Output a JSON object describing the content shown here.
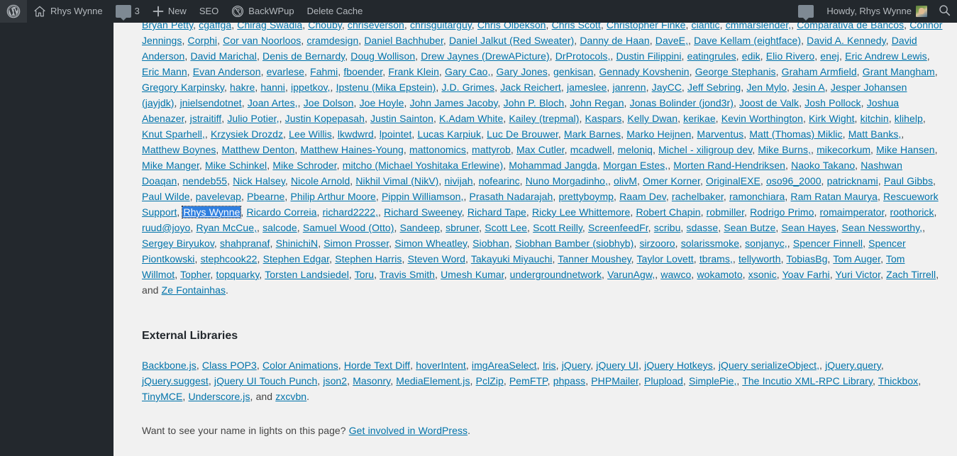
{
  "adminbar": {
    "logo_icon": "wordpress-logo-icon",
    "site_name": "Rhys Wynne",
    "site_icon": "home-icon",
    "comments_icon": "comment-bubble-icon",
    "comments_count": "3",
    "new_icon": "plus-icon",
    "new_label": "New",
    "seo_label": "SEO",
    "backwpup_icon": "backwpup-icon",
    "backwpup_label": "BackWPup",
    "delete_cache_label": "Delete Cache",
    "right_bubble_icon": "speech-bubble-icon",
    "howdy_label": "Howdy, Rhys Wynne",
    "avatar_name": "user-avatar",
    "search_icon": "search-icon"
  },
  "credits": {
    "contributor_lines": [
      "Bryan Petty, cgaffga, Chirag Swadia, Chouby, chriseverson, chrisguitarguy, Chris Olbekson, Chris Scott, Christopher Finke, ciantic, cmmarslender,",
      "Comparativa de Bancos, Connor Jennings, Corphi, Cor van Noorloos, cramdesign, Daniel Bachhuber, Daniel Jalkut (Red Sweater), Danny de Haan, DaveE,",
      "Dave Kellam (eightface), David A. Kennedy, David Anderson, David Marichal, Denis de Bernardy, Doug Wollison, Drew Jaynes (DrewAPicture), DrProtocols,",
      "Dustin Filippini, eatingrules, edik, Elio Rivero, enej, Eric Andrew Lewis, Eric Mann, Evan Anderson, evarlese, Fahmi, fboender, Frank Klein, Gary Cao,",
      "Gary Jones, genkisan, Gennady Kovshenin, George Stephanis, Graham Armfield, Grant Mangham, Gregory Karpinsky, hakre, hanni, ippetkov,",
      "Ipstenu (Mika Epstein), J.D. Grimes, Jack Reichert, jameslee, janrenn, JayCC, Jeff Sebring, Jen Mylo, Jesin A, Jesper Johansen (jayjdk), jnielsendotnet, Joan Artes,",
      "Joe Dolson, Joe Hoyle, John James Jacoby, John P. Bloch, John Regan, Jonas Bolinder (jond3r), Joost de Valk, Josh Pollock, Joshua Abenazer, jstraitiff, Julio Potier,",
      "Justin Kopepasah, Justin Sainton, K.Adam White, Kailey (trepmal), Kaspars, Kelly Dwan, kerikae, Kevin Worthington, Kirk Wight, kitchin, klihelp, Knut Sparhell,",
      "Krzysiek Drozdz, Lee Willis, lkwdwrd, lpointet, Lucas Karpiuk, Luc De Brouwer, Mark Barnes, Marko Heijnen, Marventus, Matt (Thomas) Miklic, Matt Banks,",
      "Matthew Boynes, Matthew Denton, Matthew Haines-Young, mattonomics, mattyrob, Max Cutler, mcadwell, meloniq, Michel - xiligroup dev, Mike Burns,",
      "mikecorkum, Mike Hansen, Mike Manger, Mike Schinkel, Mike Schroder, mitcho (Michael Yoshitaka Erlewine), Mohammad Jangda, Morgan Estes,",
      "Morten Rand-Hendriksen, Naoko Takano, Nashwan Doaqan, nendeb55, Nick Halsey, Nicole Arnold, Nikhil Vimal (NikV), nivijah, nofearinc, Nuno Morgadinho,",
      "olivM, Omer Korner, OriginalEXE, oso96_2000, patricknami, Paul Gibbs, Paul Wilde, pavelevap, Pbearne, Philip Arthur Moore, Pippin Williamson,",
      "Prasath Nadarajah, prettyboymp, Raam Dev, rachelbaker, ramonchiara, Ram Ratan Maurya, Rescuework Support, Rhys Wynne, Ricardo Correia, richard2222,",
      "Richard Sweeney, Richard Tape, Ricky Lee Whittemore, Robert Chapin, robmiller, Rodrigo Primo, romaimperator, roothorick, ruud@joyo, Ryan McCue,",
      "salcode, Samuel Wood (Otto), Sandeep, sbruner, Scott Lee, Scott Reilly, ScreenfeedFr, scribu, sdasse, Sean Butze, Sean Hayes, Sean Nessworthy,",
      "Sergey Biryukov, shahpranaf, ShinichiN, Simon Prosser, Simon Wheatley, Siobhan, Siobhan Bamber (siobhyb), sirzooro, solarissmoke, sonjanyc,",
      "Spencer Finnell, Spencer Piontkowski, stephcook22, Stephen Edgar, Stephen Harris, Steven Word, Takayuki Miyauchi, Tanner Moushey, Taylor Lovett, tbrams,",
      "tellyworth, TobiasBg, Tom Auger, Tom Willmot, Topher, topquarky, Torsten Landsiedel, Toru, Travis Smith, Umesh Kumar, undergroundnetwork, VarunAgw,",
      "wawco, wokamoto, xsonic, Yoav Farhi, Yuri Victor, Zach Tirrell, and Ze Fontainhas."
    ],
    "focused_link": "Rhys Wynne",
    "and_label": "and"
  },
  "external_libraries": {
    "heading": "External Libraries",
    "lines": [
      "Backbone.js, Class POP3, Color Animations, Horde Text Diff, hoverIntent, imgAreaSelect, Iris, jQuery, jQuery UI, jQuery Hotkeys, jQuery serializeObject,",
      "jQuery.query, jQuery.suggest, jQuery UI Touch Punch, json2, Masonry, MediaElement.js, PclZip, PemFTP, phpass, PHPMailer, Plupload, SimplePie,",
      "The Incutio XML-RPC Library, Thickbox, TinyMCE, Underscore.js, and zxcvbn."
    ]
  },
  "footer": {
    "prompt_text": "Want to see your name in lights on this page?",
    "link_text": "Get involved in WordPress",
    "period": "."
  },
  "colors": {
    "adminbar_bg": "#23282d",
    "adminbar_text": "#b4b9be",
    "page_bg": "#f1f1f1",
    "link": "#0073aa",
    "body_text": "#444444",
    "heading": "#23282d",
    "focus_highlight": "#2f7fe0"
  }
}
